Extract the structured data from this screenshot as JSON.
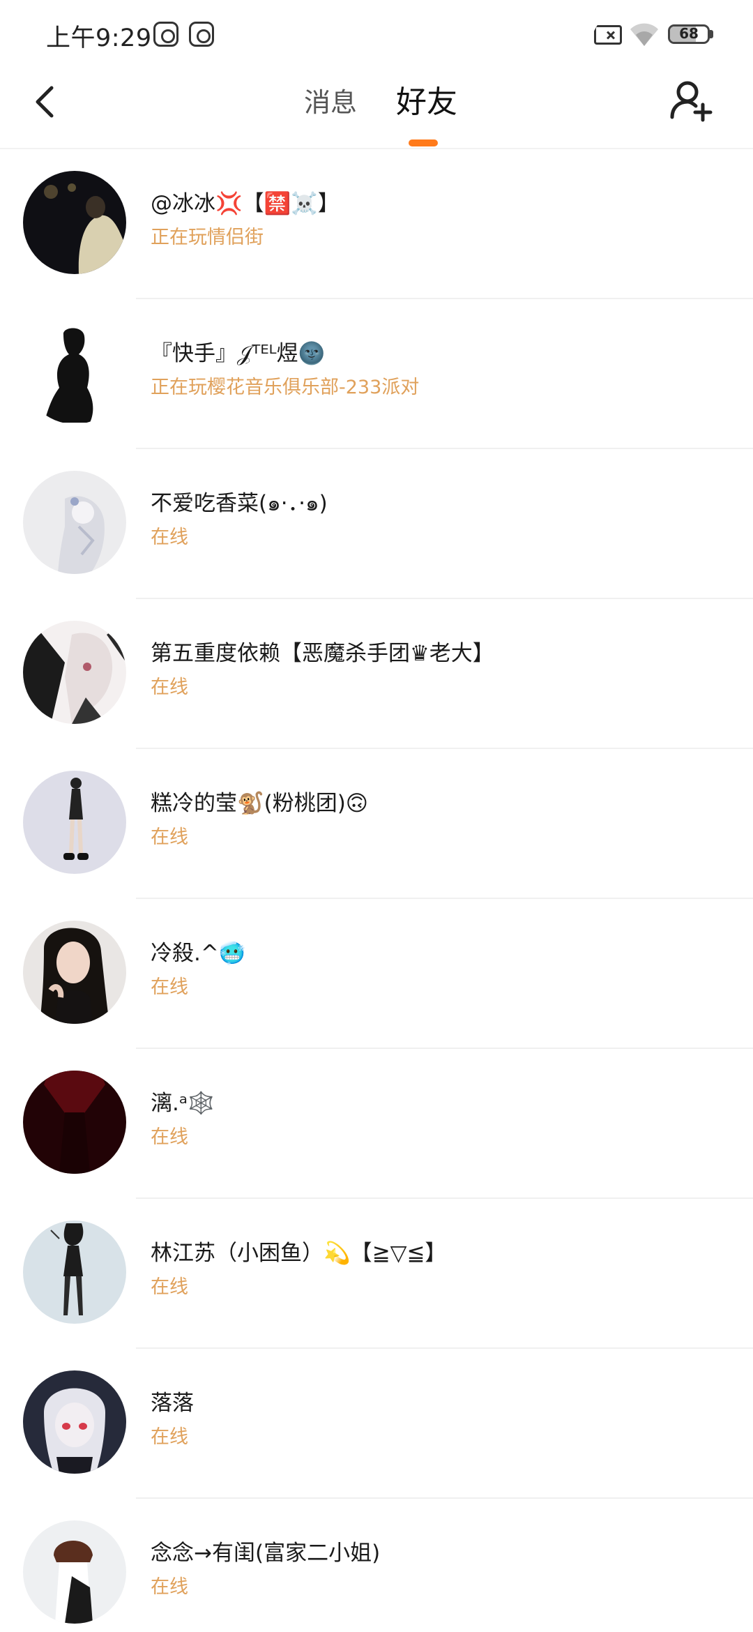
{
  "status_bar": {
    "time": "上午9:29",
    "battery": "68",
    "battery_level_percent": 68,
    "icons": [
      "notification-icon",
      "notification-icon",
      "sim-error-icon",
      "wifi-icon",
      "battery-icon"
    ]
  },
  "header": {
    "back_icon": "chevron-left-icon",
    "tabs": [
      {
        "label": "消息",
        "selected": false
      },
      {
        "label": "好友",
        "selected": true
      }
    ],
    "add_friend_icon": "add-person-icon",
    "accent_color": "#ff7a1a"
  },
  "status_color": "#e0a15b",
  "friends": [
    {
      "name": "@冰冰💢【🈲☠️】",
      "status": "正在玩情侣街"
    },
    {
      "name": "『快手』𝒥ᵀᴱᴸ煜🌚",
      "status": "正在玩樱花音乐俱乐部-233派对"
    },
    {
      "name": "不爱吃香菜(๑·．·๑)",
      "status": "在线"
    },
    {
      "name": "第五重度依赖【恶魔杀手团♛老大】",
      "status": "在线"
    },
    {
      "name": "糕冷的莹🐒(粉桃团)🙃",
      "status": "在线"
    },
    {
      "name": "冷殺.^🥶",
      "status": "在线"
    },
    {
      "name": "漓.ᵃ🕸️",
      "status": "在线"
    },
    {
      "name": "林江苏（小困鱼）💫【≧▽≦】",
      "status": "在线"
    },
    {
      "name": "落落",
      "status": "在线"
    },
    {
      "name": "念念→有闺(富家二小姐)",
      "status": "在线"
    }
  ]
}
